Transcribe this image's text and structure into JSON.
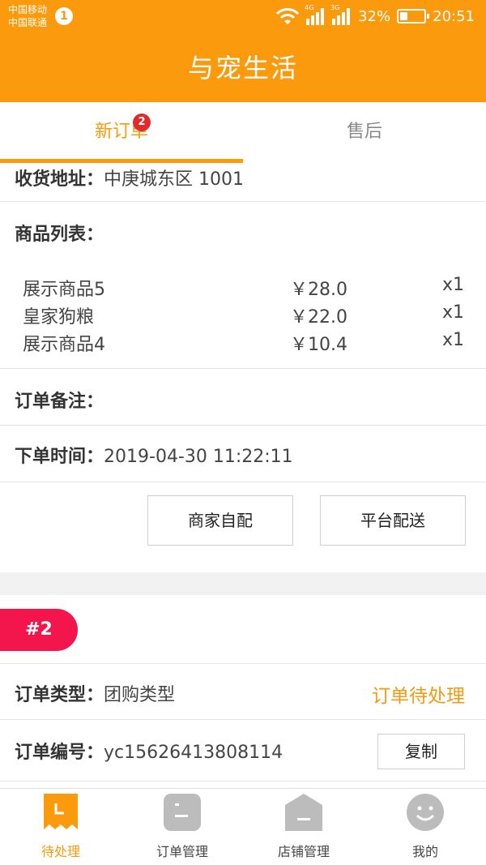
{
  "status_bar": {
    "carrier_1": "中国移动",
    "carrier_2": "中国联通",
    "notification_count": "1",
    "net_1": "4G",
    "net_2": "3G",
    "battery": "32%",
    "battery_level": 0.32,
    "time": "20:51"
  },
  "app": {
    "title": "与宠生活"
  },
  "tabs": [
    {
      "label": "新订单",
      "badge": "2",
      "active": true
    },
    {
      "label": "售后",
      "active": false
    }
  ],
  "order1": {
    "address_label": "收货地址：",
    "address": "中庚城东区 1001",
    "items_label": "商品列表：",
    "items": [
      {
        "name": "展示商品5",
        "price": "￥28.0",
        "qty": "x1"
      },
      {
        "name": "皇家狗粮",
        "price": "￥22.0",
        "qty": "x1"
      },
      {
        "name": "展示商品4",
        "price": "￥10.4",
        "qty": "x1"
      }
    ],
    "note_label": "订单备注：",
    "time_label": "下单时间：",
    "time": "2019-04-30 11:22:11",
    "btn_self": "商家自配",
    "btn_platform": "平台配送"
  },
  "order2": {
    "tag": "#2",
    "type_label": "订单类型：",
    "type": "团购类型",
    "status": "订单待处理",
    "no_label": "订单编号：",
    "no": "yc15626413808114",
    "copy": "复制"
  },
  "nav": [
    {
      "label": "待处理",
      "icon": "pending-icon",
      "active": true
    },
    {
      "label": "订单管理",
      "icon": "order-icon",
      "active": false
    },
    {
      "label": "店铺管理",
      "icon": "shop-icon",
      "active": false
    },
    {
      "label": "我的",
      "icon": "profile-icon",
      "active": false
    }
  ],
  "colors": {
    "brand": "#fb9a0c",
    "tag": "#f2164c",
    "badge": "#e02b2b"
  }
}
